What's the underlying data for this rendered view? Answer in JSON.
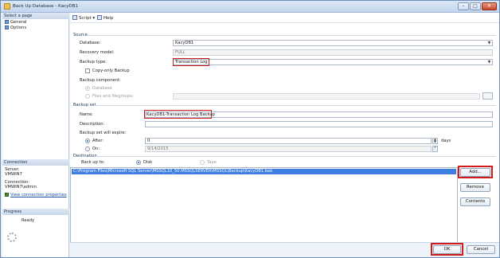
{
  "window": {
    "title": "Back Up Database - KacyDB1"
  },
  "left": {
    "select_page_header": "Select a page",
    "pages": [
      "General",
      "Options"
    ],
    "connection_header": "Connection",
    "server_label": "Server:",
    "server_value": "VMWIN7",
    "connection_label": "Connection:",
    "connection_value": "VMWIN7\\admin",
    "view_connection_link": "View connection properties",
    "progress_header": "Progress",
    "progress_status": "Ready"
  },
  "toolbar": {
    "script_label": "Script",
    "help_label": "Help"
  },
  "source": {
    "group_label": "Source",
    "database_label": "Database:",
    "database_value": "KacyDB1",
    "recovery_label": "Recovery model:",
    "recovery_value": "FULL",
    "backup_type_label": "Backup type:",
    "backup_type_value": "Transaction Log",
    "copy_only_label": "Copy-only Backup",
    "component_label": "Backup component:",
    "opt_database": "Database",
    "opt_files": "Files and filegroups:"
  },
  "backup_set": {
    "group_label": "Backup set",
    "name_label": "Name:",
    "name_value": "KacyDB1-Transaction Log  Backup",
    "description_label": "Description:",
    "description_value": "",
    "expire_label": "Backup set will expire:",
    "after_label": "After:",
    "after_value": "0",
    "days_label": "days",
    "on_label": "On:",
    "on_value": "9/14/2015"
  },
  "destination": {
    "group_label": "Destination",
    "backup_to_label": "Back up to:",
    "disk_label": "Disk",
    "tape_label": "Tape",
    "path": "C:\\Program Files\\Microsoft SQL Server\\MSSQL10_50.MSSQLSERVER\\MSSQL\\Backup\\KacyDB1.bak",
    "add_label": "Add...",
    "remove_label": "Remove",
    "contents_label": "Contents"
  },
  "footer": {
    "ok_label": "OK",
    "cancel_label": "Cancel"
  },
  "colors": {
    "highlight": "#d11b1b",
    "selection": "#3d7ee0"
  }
}
